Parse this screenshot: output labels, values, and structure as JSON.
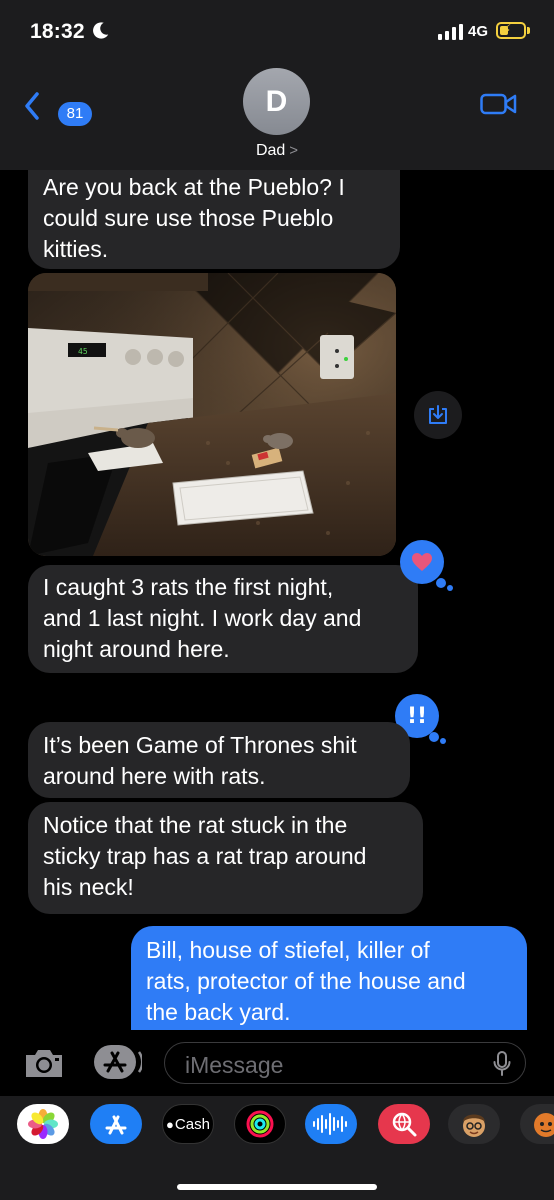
{
  "status_bar": {
    "time": "18:32",
    "network": "4G"
  },
  "header": {
    "unread_count": "81",
    "avatar_initial": "D",
    "contact_name": "Dad"
  },
  "messages": [
    {
      "direction": "incoming",
      "text": "Are you back at the Pueblo?  I\ncould sure use those Pueblo\nkitties."
    },
    {
      "direction": "incoming",
      "type": "photo"
    },
    {
      "direction": "incoming",
      "text": "I caught 3 rats the first night,\nand 1 last night.  I work day and\nnight around here.",
      "tapback": "heart"
    },
    {
      "direction": "incoming",
      "text": "It’s been Game of Thrones shit\naround here with rats.",
      "tapback": "!!"
    },
    {
      "direction": "incoming",
      "text": "Notice that the rat stuck in the\nsticky trap has a rat trap around\nhis neck!"
    },
    {
      "direction": "outgoing",
      "text": "Bill, house of stiefel, killer of\nrats, protector of the house and\nthe back yard."
    }
  ],
  "input": {
    "placeholder": "iMessage"
  },
  "app_drawer": {
    "cash_label": "Cash",
    "apps": [
      "photos-app",
      "app-store-app",
      "apple-cash-app",
      "activity-app",
      "audio-message-app",
      "image-search-app",
      "memoji-app",
      "animoji-app"
    ]
  },
  "colors": {
    "accent": "#2f7cf6",
    "incoming_bubble": "#262628",
    "background": "#000000",
    "header": "#1c1c1e",
    "heart": "#e9567b"
  }
}
